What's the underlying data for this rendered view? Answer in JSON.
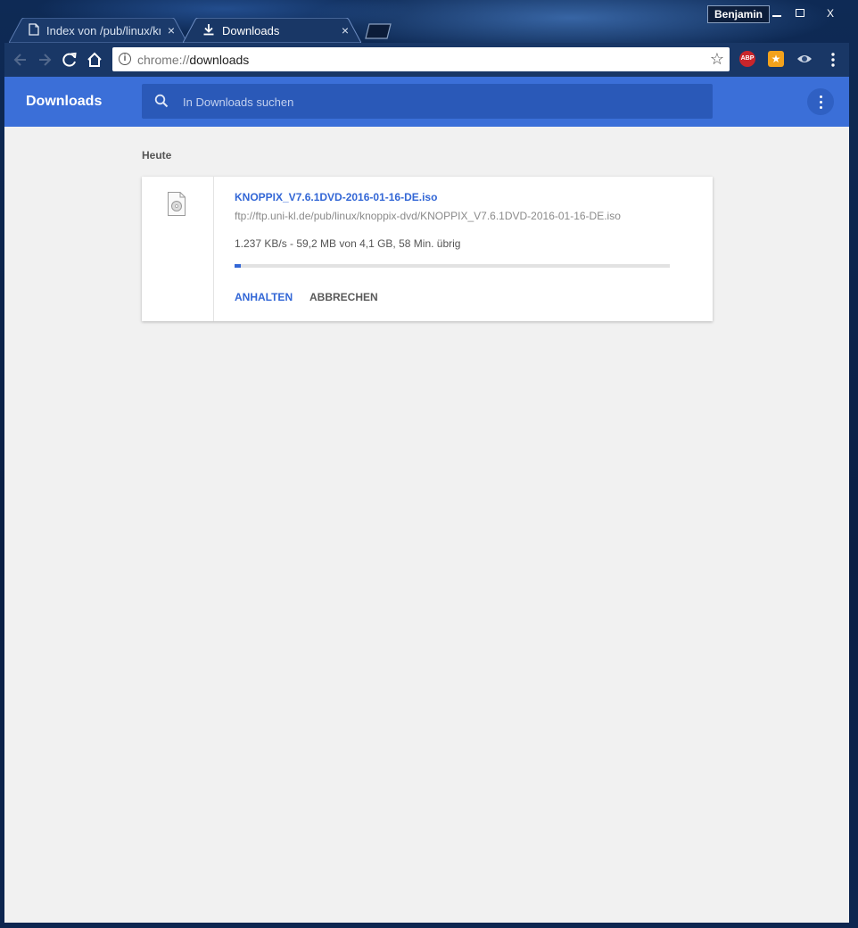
{
  "window": {
    "profile_name": "Benjamin",
    "min_label": "",
    "max_label": "",
    "close_label": "X"
  },
  "tabs": [
    {
      "title": "Index von /pub/linux/knoppix-dvd",
      "icon": "page-icon",
      "active": false
    },
    {
      "title": "Downloads",
      "icon": "download-icon",
      "active": true
    }
  ],
  "tab_close_label": "×",
  "toolbar": {
    "url_scheme": "chrome://",
    "url_host": "downloads",
    "extensions": [
      "adblock-plus-icon",
      "bookmark-star-extension-icon",
      "eye-extension-icon"
    ]
  },
  "downloads": {
    "title": "Downloads",
    "search_placeholder": "In Downloads suchen",
    "section": "Heute",
    "items": [
      {
        "file_name": "KNOPPIX_V7.6.1DVD-2016-01-16-DE.iso",
        "url": "ftp://ftp.uni-kl.de/pub/linux/knoppix-dvd/KNOPPIX_V7.6.1DVD-2016-01-16-DE.iso",
        "status": "1.237 KB/s - 59,2 MB von 4,1 GB, 58 Min. übrig",
        "progress_percent": 1.4,
        "pause_label": "ANHALTEN",
        "cancel_label": "ABBRECHEN"
      }
    ]
  },
  "colors": {
    "header": "#3b6fd8",
    "search_bg": "#2a59b8",
    "accent": "#3367d6",
    "page_bg": "#f1f1f1",
    "toolbar": "#193766"
  }
}
